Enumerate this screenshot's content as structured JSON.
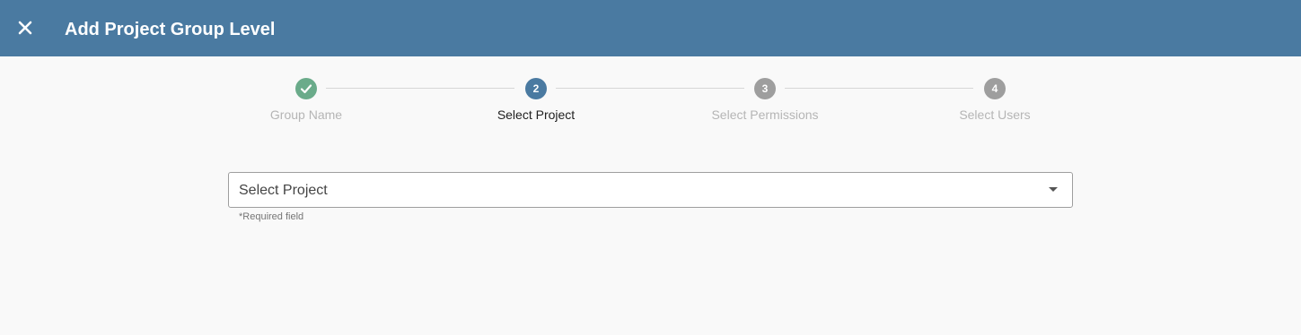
{
  "header": {
    "title": "Add Project Group Level",
    "close_icon": "close-icon",
    "background": "#4a7aa1"
  },
  "stepper": {
    "steps": [
      {
        "number": "",
        "label": "Group Name",
        "status": "completed",
        "icon": "check-icon",
        "color": "#6aab8a"
      },
      {
        "number": "2",
        "label": "Select Project",
        "status": "active",
        "color": "#4a7aa1"
      },
      {
        "number": "3",
        "label": "Select Permissions",
        "status": "pending",
        "color": "#9e9e9e"
      },
      {
        "number": "4",
        "label": "Select Users",
        "status": "pending",
        "color": "#9e9e9e"
      }
    ]
  },
  "project_select": {
    "placeholder": "Select Project",
    "helper_text": "*Required field",
    "icon": "chevron-down-icon"
  }
}
